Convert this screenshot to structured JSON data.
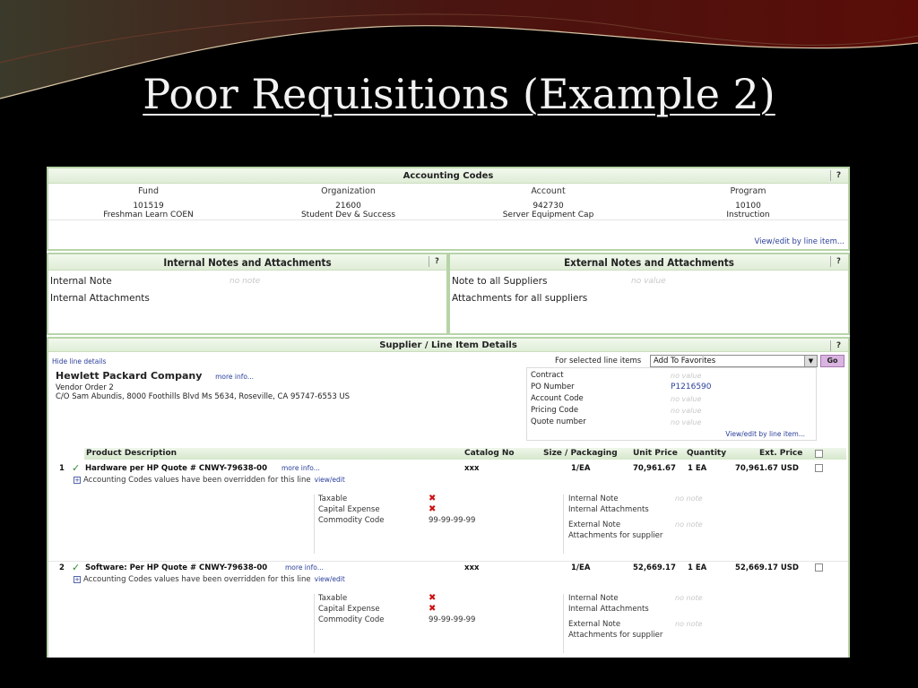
{
  "slide": {
    "title": "Poor Requisitions (Example 2)"
  },
  "accounting": {
    "title": "Accounting Codes",
    "help": "?",
    "columns": [
      {
        "label": "Fund",
        "code": "101519",
        "name": "Freshman Learn COEN"
      },
      {
        "label": "Organization",
        "code": "21600",
        "name": "Student Dev & Success"
      },
      {
        "label": "Account",
        "code": "942730",
        "name": "Server Equipment Cap"
      },
      {
        "label": "Program",
        "code": "10100",
        "name": "Instruction"
      }
    ],
    "edit_link": "View/edit by line item..."
  },
  "internal_notes": {
    "title": "Internal Notes and Attachments",
    "help": "?",
    "note_label": "Internal Note",
    "note_value": "no note",
    "attach_label": "Internal Attachments"
  },
  "external_notes": {
    "title": "External Notes and Attachments",
    "help": "?",
    "note_label": "Note to all Suppliers",
    "note_value": "no value",
    "attach_label": "Attachments for all suppliers"
  },
  "supplier": {
    "title": "Supplier / Line Item Details",
    "help": "?",
    "hide_link": "Hide line details",
    "for_selected": "For selected line items",
    "action_select": "Add To Favorites",
    "go": "Go",
    "vendor_name": "Hewlett Packard Company",
    "vendor_more": "more info...",
    "vendor_order": "Vendor Order 2",
    "vendor_address": "C/O Sam Abundis, 8000 Foothills Blvd Ms 5634, Roseville, CA 95747-6553 US",
    "contract": {
      "rows": [
        {
          "label": "Contract",
          "value": "no value"
        },
        {
          "label": "PO Number",
          "value": "P1216590"
        },
        {
          "label": "Account Code",
          "value": "no value"
        },
        {
          "label": "Pricing Code",
          "value": "no value"
        },
        {
          "label": "Quote number",
          "value": "no value"
        }
      ],
      "link": "View/edit by line item..."
    },
    "columns": {
      "desc": "Product Description",
      "catalog": "Catalog No",
      "size": "Size / Packaging",
      "unit_price": "Unit Price",
      "quantity": "Quantity",
      "ext_price": "Ext. Price"
    },
    "items": [
      {
        "num": "1",
        "desc": "Hardware per HP Quote # CNWY-79638-00",
        "more": "more info...",
        "catalog": "xxx",
        "size": "1/EA",
        "unit_price": "70,961.67",
        "quantity": "1 EA",
        "ext_price": "70,961.67 USD",
        "override": "Accounting Codes values have been overridden for this line",
        "override_link": "view/edit",
        "taxable_label": "Taxable",
        "capital_label": "Capital Expense",
        "commodity_label": "Commodity Code",
        "commodity_value": "99-99-99-99",
        "internal_note_label": "Internal Note",
        "internal_note_value": "no note",
        "internal_attach_label": "Internal Attachments",
        "external_note_label": "External Note",
        "external_note_value": "no note",
        "supplier_attach_label": "Attachments for supplier"
      },
      {
        "num": "2",
        "desc": "Software: Per HP Quote # CNWY-79638-00",
        "more": "more info...",
        "catalog": "xxx",
        "size": "1/EA",
        "unit_price": "52,669.17",
        "quantity": "1 EA",
        "ext_price": "52,669.17 USD",
        "override": "Accounting Codes values have been overridden for this line",
        "override_link": "view/edit",
        "taxable_label": "Taxable",
        "capital_label": "Capital Expense",
        "commodity_label": "Commodity Code",
        "commodity_value": "99-99-99-99",
        "internal_note_label": "Internal Note",
        "internal_note_value": "no note",
        "internal_attach_label": "Internal Attachments",
        "external_note_label": "External Note",
        "external_note_value": "no note",
        "supplier_attach_label": "Attachments for supplier"
      }
    ]
  },
  "colors": {
    "panel_border": "#b7d4a8",
    "link": "#2a3f9a",
    "check": "#2c8a2c",
    "cross": "#cc1111"
  }
}
